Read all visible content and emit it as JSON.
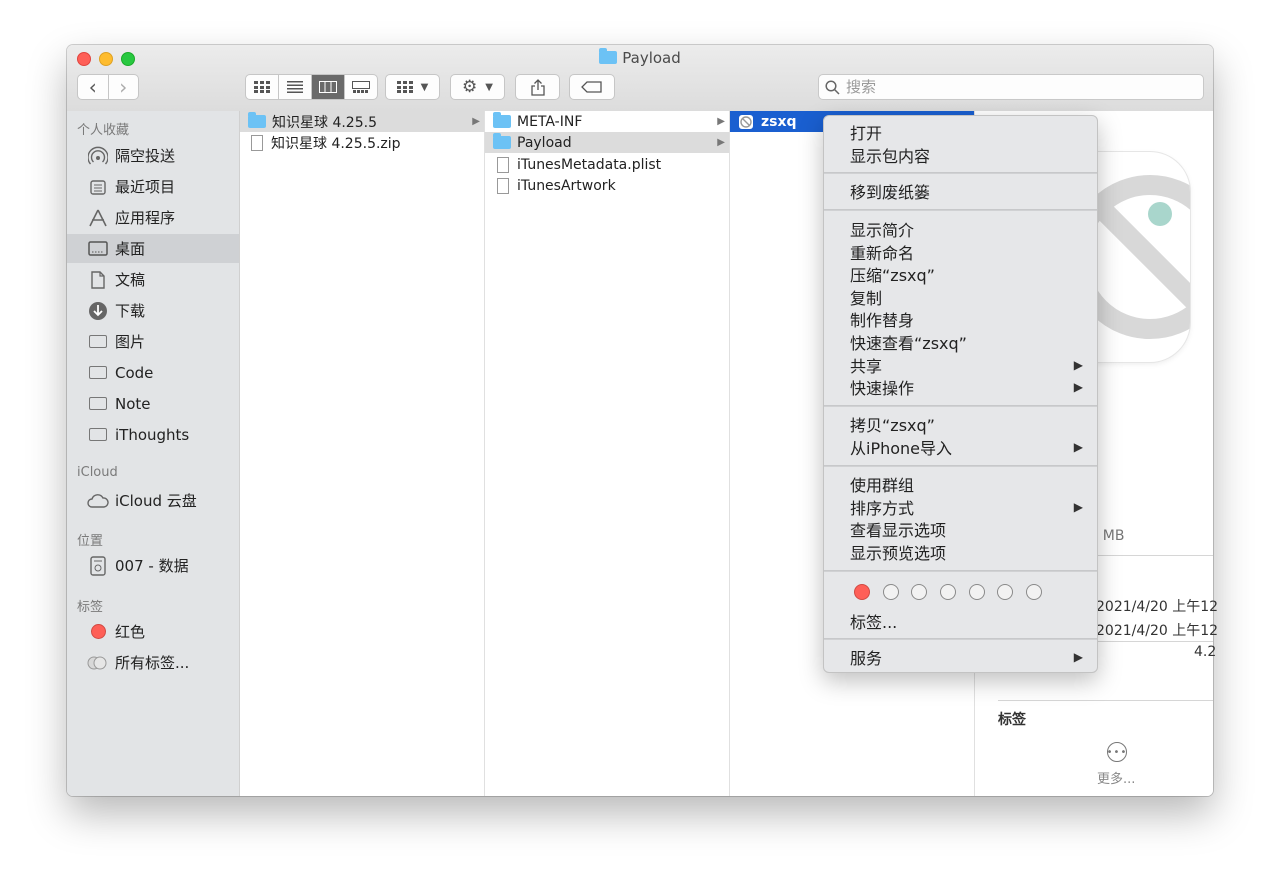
{
  "window": {
    "title": "Payload"
  },
  "toolbar": {
    "back": "‹",
    "forward": "›",
    "search_placeholder": "搜索"
  },
  "sidebar": {
    "sections": {
      "favorites": "个人收藏",
      "icloud": "iCloud",
      "locations": "位置",
      "tags": "标签"
    },
    "favorites": [
      {
        "label": "隔空投送",
        "icon": "airdrop-icon"
      },
      {
        "label": "最近项目",
        "icon": "recents-icon"
      },
      {
        "label": "应用程序",
        "icon": "applications-icon"
      },
      {
        "label": "桌面",
        "icon": "desktop-icon"
      },
      {
        "label": "文稿",
        "icon": "documents-icon"
      },
      {
        "label": "下载",
        "icon": "downloads-icon"
      },
      {
        "label": "图片",
        "icon": "folder-icon"
      },
      {
        "label": "Code",
        "icon": "folder-icon"
      },
      {
        "label": "Note",
        "icon": "folder-icon"
      },
      {
        "label": "iThoughts",
        "icon": "folder-icon"
      }
    ],
    "icloud": [
      {
        "label": "iCloud 云盘",
        "icon": "cloud-icon"
      }
    ],
    "locations": [
      {
        "label": "007 - 数据",
        "icon": "disk-icon"
      }
    ],
    "tags": [
      {
        "label": "红色",
        "color": "#fe5f57"
      },
      {
        "label": "所有标签...",
        "color": "#c8c8c8"
      }
    ]
  },
  "columns": {
    "col1": [
      "知识星球 4.25.5",
      "知识星球 4.25.5.zip"
    ],
    "col2": [
      "META-INF",
      "Payload",
      "iTunesMetadata.plist",
      "iTunesArtwork"
    ],
    "col3": [
      "zsxq"
    ]
  },
  "preview": {
    "size": ".2 MB",
    "created": "2021/4/20 上午12",
    "modified": "2021/4/20 上午12",
    "version": "4.2",
    "tags_label": "标签",
    "more_label": "更多..."
  },
  "context_menu": {
    "items": [
      {
        "label": "打开"
      },
      {
        "label": "显示包内容"
      },
      {
        "label": "移到废纸篓"
      },
      {
        "label": "显示简介"
      },
      {
        "label": "重新命名"
      },
      {
        "label": "压缩“zsxq”"
      },
      {
        "label": "复制"
      },
      {
        "label": "制作替身"
      },
      {
        "label": "快速查看“zsxq”"
      },
      {
        "label": "共享",
        "submenu": true
      },
      {
        "label": "快速操作",
        "submenu": true
      },
      {
        "label": "拷贝“zsxq”"
      },
      {
        "label": "从iPhone导入",
        "submenu": true
      },
      {
        "label": "使用群组"
      },
      {
        "label": "排序方式",
        "submenu": true
      },
      {
        "label": "查看显示选项"
      },
      {
        "label": "显示预览选项"
      },
      {
        "label": "标签..."
      },
      {
        "label": "服务",
        "submenu": true
      }
    ],
    "submenu_arrow": "▶",
    "tag_colors": [
      "#fe5f57",
      "none",
      "none",
      "none",
      "none",
      "none",
      "none"
    ]
  }
}
